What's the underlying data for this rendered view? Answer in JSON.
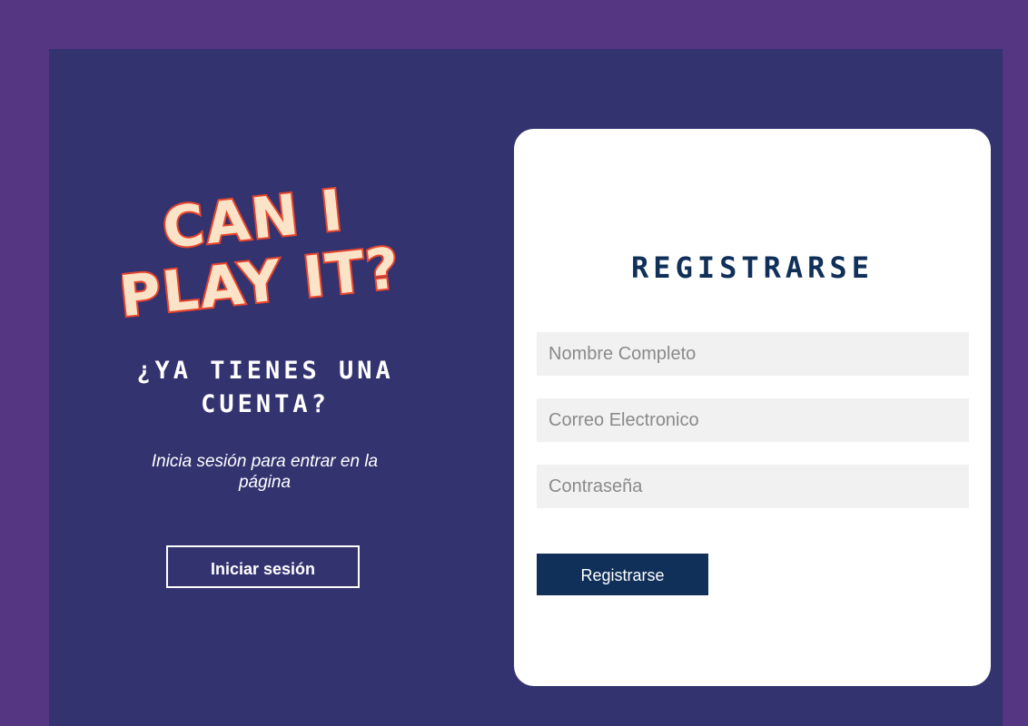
{
  "logo": {
    "line1": "CAN I",
    "line2": "PLAY IT?"
  },
  "login_side": {
    "title": "¿YA TIENES UNA CUENTA?",
    "subtitle": "Inicia sesión para entrar en la página",
    "login_button_label": "Iniciar sesión"
  },
  "register_form": {
    "title": "REGISTRARSE",
    "fields": [
      {
        "placeholder": "Nombre Completo",
        "value": ""
      },
      {
        "placeholder": "Correo Electronico",
        "value": ""
      },
      {
        "placeholder": "Contraseña",
        "value": ""
      }
    ],
    "submit_label": "Registrarse"
  },
  "colors": {
    "outer_background": "#543683",
    "panel_background": "#333370",
    "card_background": "#ffffff",
    "primary": "#10305a",
    "input_background": "#f1f1f1",
    "logo_fill": "#fbe3c8",
    "logo_outline": "#e8452c"
  }
}
